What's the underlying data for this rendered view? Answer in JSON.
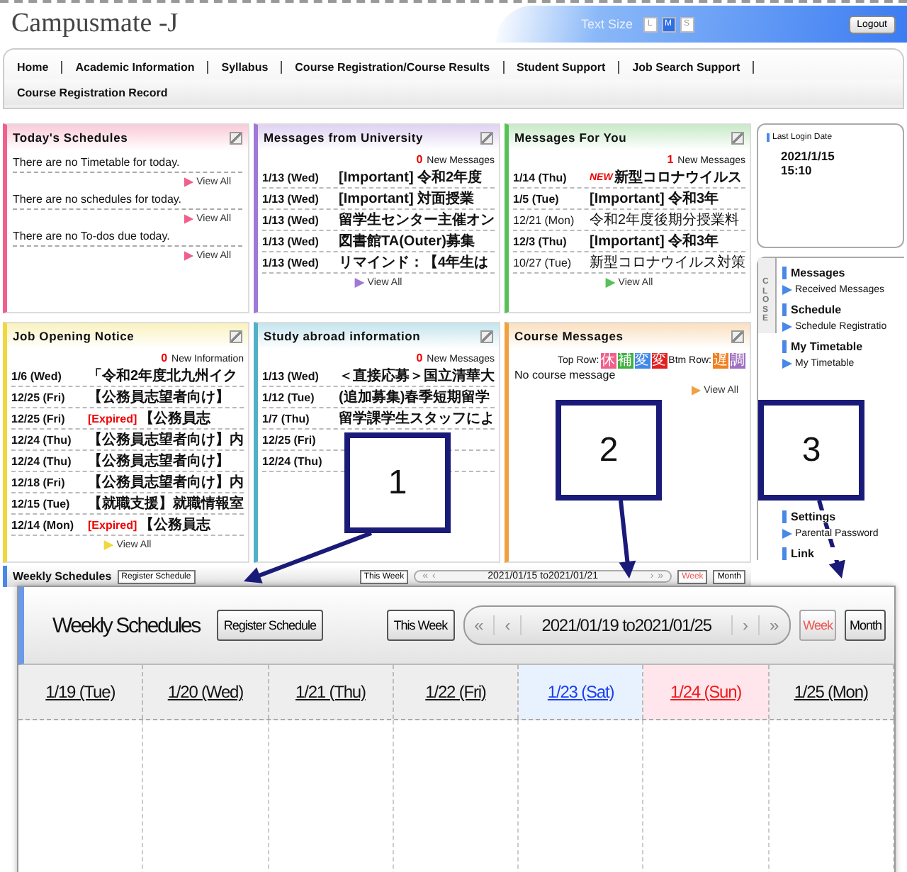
{
  "header": {
    "logo": "Campusmate -J",
    "text_size_label": "Text Size",
    "text_sizes": [
      {
        "label": "L",
        "selected": false
      },
      {
        "label": "M",
        "selected": true
      },
      {
        "label": "S",
        "selected": false
      }
    ],
    "logout": "Logout"
  },
  "nav": {
    "tabs": [
      "Home",
      "Academic Information",
      "Syllabus",
      "Course Registration/Course Results",
      "Student Support",
      "Job Search Support"
    ],
    "sub_tabs": [
      "Course Registration Record"
    ]
  },
  "panels": [
    {
      "kind": "today",
      "title": "Today's Schedules",
      "color": "#f0608c",
      "entries": [
        {
          "text": "There are no Timetable for today.",
          "link": "View All"
        },
        {
          "text": "There are no schedules for today.",
          "link": "View All"
        },
        {
          "text": "There are no To-dos due today.",
          "link": "View All"
        }
      ]
    },
    {
      "kind": "list",
      "title": "Messages from University",
      "color": "#a078d8",
      "count": "0",
      "count_label": "New Messages",
      "link": "View All",
      "rows": [
        {
          "date": "1/13 (Wed)",
          "title": "[Important] 令和2年度",
          "bold": true
        },
        {
          "date": "1/13 (Wed)",
          "title": "[Important] 対面授業",
          "bold": true
        },
        {
          "date": "1/13 (Wed)",
          "title": "留学生センター主催オン",
          "bold": true
        },
        {
          "date": "1/13 (Wed)",
          "title": "図書館TA(Outer)募集",
          "bold": true
        },
        {
          "date": "1/13 (Wed)",
          "title": "リマインド：【4年生は",
          "bold": true
        }
      ]
    },
    {
      "kind": "list",
      "title": "Messages For You",
      "color": "#58c058",
      "count": "1",
      "count_label": "New Messages",
      "link": "View All",
      "rows": [
        {
          "date": "1/14 (Thu)",
          "badge": "NEW",
          "title": "新型コロナウイルス",
          "bold": true
        },
        {
          "date": "1/5 (Tue)",
          "title": "[Important] 令和3年",
          "bold": true
        },
        {
          "date": "12/21 (Mon)",
          "title": "令和2年度後期分授業料",
          "bold": false
        },
        {
          "date": "12/3 (Thu)",
          "title": "[Important] 令和3年",
          "bold": true
        },
        {
          "date": "10/27 (Tue)",
          "title": "新型コロナウイルス対策",
          "bold": false
        }
      ]
    },
    {
      "kind": "list",
      "title": "Job Opening Notice",
      "color": "#f0d840",
      "count": "0",
      "count_label": "New Information",
      "link": "View All",
      "rows": [
        {
          "date": "1/6 (Wed)",
          "title": "「令和2年度北九州イク",
          "bold": true
        },
        {
          "date": "12/25 (Fri)",
          "title": "【公務員志望者向け】",
          "bold": true
        },
        {
          "date": "12/25 (Fri)",
          "tag": "[Expired]",
          "title": "【公務員志",
          "bold": true
        },
        {
          "date": "12/24 (Thu)",
          "title": "【公務員志望者向け】内",
          "bold": true
        },
        {
          "date": "12/24 (Thu)",
          "title": "【公務員志望者向け】",
          "bold": true
        },
        {
          "date": "12/18 (Fri)",
          "title": "【公務員志望者向け】内",
          "bold": true
        },
        {
          "date": "12/15 (Tue)",
          "title": "【就職支援】就職情報室",
          "bold": true
        },
        {
          "date": "12/14 (Mon)",
          "tag": "[Expired]",
          "title": "【公務員志",
          "bold": true
        }
      ]
    },
    {
      "kind": "list",
      "title": "Study abroad information",
      "color": "#50b0c8",
      "count": "0",
      "count_label": "New Messages",
      "rows": [
        {
          "date": "1/13 (Wed)",
          "title": "＜直接応募＞国立清華大",
          "bold": true
        },
        {
          "date": "1/12 (Tue)",
          "title": "(追加募集)春季短期留学",
          "bold": true
        },
        {
          "date": "1/7 (Thu)",
          "title": "留学課学生スタッフによ",
          "bold": true
        },
        {
          "date": "12/25 (Fri)",
          "bold": true
        },
        {
          "date": "12/24 (Thu)",
          "bold": true
        }
      ]
    },
    {
      "kind": "course",
      "title": "Course Messages",
      "color": "#f0a040",
      "top_label": "Top Row:",
      "top_icons": [
        {
          "text": "休",
          "color": "#f0608c"
        },
        {
          "text": "補",
          "color": "#40b040"
        },
        {
          "text": "変",
          "color": "#4088e8"
        },
        {
          "text": "変",
          "color": "#e02020"
        }
      ],
      "bottom_label": "Btm Row:",
      "bottom_icons": [
        {
          "text": "遅",
          "color": "#f08020"
        },
        {
          "text": "調",
          "color": "#a070c0"
        }
      ],
      "message": "No course message",
      "link": "View All"
    }
  ],
  "sidebar": {
    "login_label": "Last Login Date",
    "login_date": "2021/1/15",
    "login_time": "15:10",
    "close_tab": "CLOSE",
    "sections": [
      {
        "heading": "Messages",
        "items": [
          "Received Messages"
        ]
      },
      {
        "heading": "Schedule",
        "items": [
          "Schedule Registratio"
        ]
      },
      {
        "heading": "My Timetable",
        "items": [
          "My Timetable"
        ]
      },
      {
        "heading": "Settings",
        "items": [
          "Parental Password"
        ]
      },
      {
        "heading": "Link"
      }
    ]
  },
  "weekly": {
    "title": "Weekly Schedules",
    "register": "Register Schedule",
    "this_week": "This Week",
    "range": "2021/01/15 to2021/01/21",
    "arrows": [
      "«",
      "‹",
      "›",
      "»"
    ],
    "views": [
      {
        "label": "Week",
        "selected": true
      },
      {
        "label": "Month",
        "selected": false
      }
    ]
  },
  "zoom": {
    "title": "Weekly Schedules",
    "register": "Register Schedule",
    "this_week": "This Week",
    "range": "2021/01/19 to2021/01/25",
    "arrows": [
      "«",
      "‹",
      "›",
      "»"
    ],
    "views": [
      {
        "label": "Week",
        "selected": true
      },
      {
        "label": "Month",
        "selected": false
      }
    ],
    "days": [
      {
        "label": "1/19 (Tue)",
        "kind": "weekday"
      },
      {
        "label": "1/20 (Wed)",
        "kind": "weekday"
      },
      {
        "label": "1/21 (Thu)",
        "kind": "weekday"
      },
      {
        "label": "1/22 (Fri)",
        "kind": "weekday"
      },
      {
        "label": "1/23 (Sat)",
        "kind": "saturday"
      },
      {
        "label": "1/24 (Sun)",
        "kind": "sunday"
      },
      {
        "label": "1/25 (Mon)",
        "kind": "weekday"
      }
    ]
  },
  "callouts": [
    "1",
    "2",
    "3"
  ]
}
